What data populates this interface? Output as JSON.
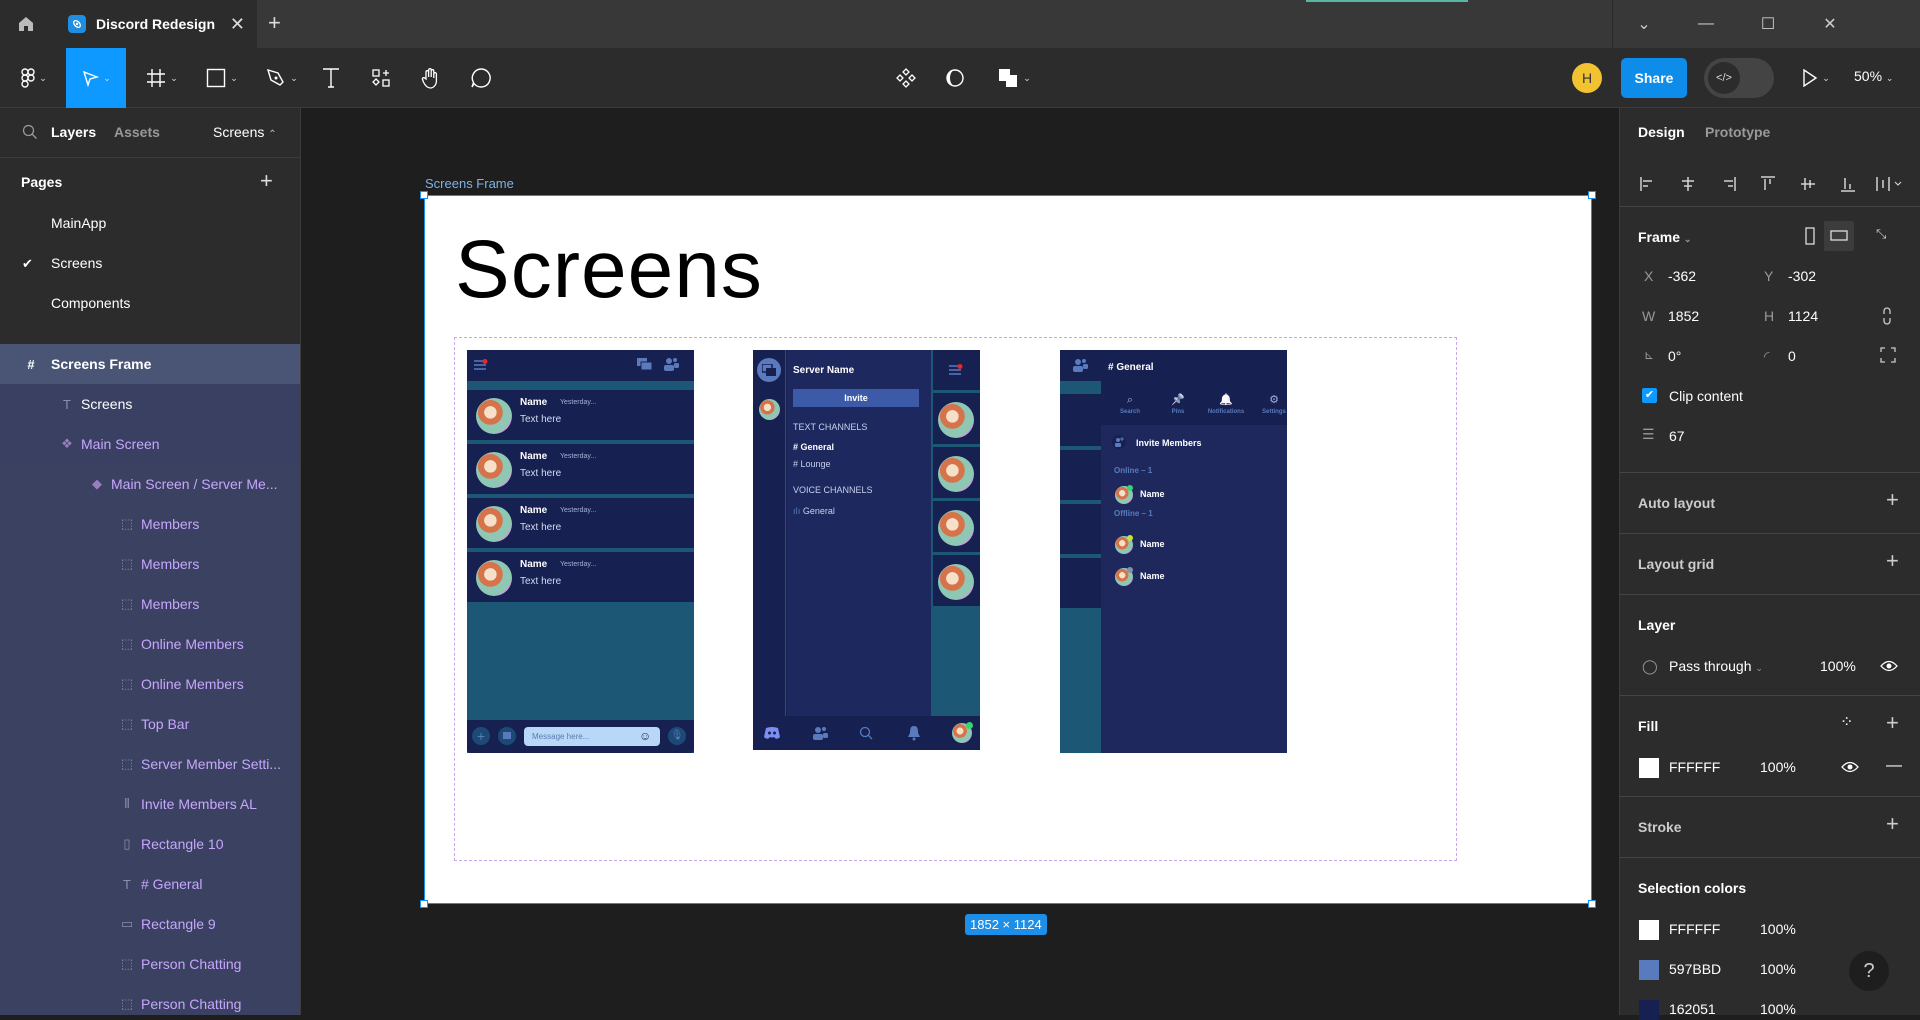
{
  "titlebar": {
    "document_title": "Discord Redesign",
    "new_tab_label": "+"
  },
  "toolbar": {
    "tools": [
      "main-menu",
      "move",
      "frame",
      "shape",
      "pen",
      "text",
      "resources",
      "hand",
      "comment"
    ],
    "center_tools": [
      "components",
      "mask",
      "boolean"
    ],
    "avatar_initial": "H",
    "share_label": "Share",
    "zoom_label": "50%"
  },
  "left_panel": {
    "tabs": {
      "layers": "Layers",
      "assets": "Assets",
      "page_switcher": "Screens"
    },
    "pages_header": "Pages",
    "pages": [
      {
        "label": "MainApp",
        "current": false
      },
      {
        "label": "Screens",
        "current": true
      },
      {
        "label": "Components",
        "current": false
      }
    ],
    "layers": [
      {
        "label": "Screens Frame",
        "icon": "frame-icon",
        "indent": 0,
        "selected": true
      },
      {
        "label": "Screens",
        "icon": "text-icon",
        "indent": 1
      },
      {
        "label": "Main Screen",
        "icon": "component-set-icon",
        "indent": 1
      },
      {
        "label": "Main Screen / Server Me...",
        "icon": "component-variant-icon",
        "indent": 2
      },
      {
        "label": "Members",
        "icon": "group-icon",
        "indent": 3
      },
      {
        "label": "Members",
        "icon": "group-icon",
        "indent": 3
      },
      {
        "label": "Members",
        "icon": "group-icon",
        "indent": 3
      },
      {
        "label": "Online Members",
        "icon": "group-icon",
        "indent": 3
      },
      {
        "label": "Online Members",
        "icon": "group-icon",
        "indent": 3
      },
      {
        "label": "Top Bar",
        "icon": "group-icon",
        "indent": 3
      },
      {
        "label": "Server Member Setti...",
        "icon": "group-icon",
        "indent": 3
      },
      {
        "label": "Invite Members AL",
        "icon": "auto-layout-icon",
        "indent": 3
      },
      {
        "label": "Rectangle 10",
        "icon": "rectangle-vertical-icon",
        "indent": 3
      },
      {
        "label": "# General",
        "icon": "text-icon",
        "indent": 3
      },
      {
        "label": "Rectangle 9",
        "icon": "rectangle-horizontal-icon",
        "indent": 3
      },
      {
        "label": "Person Chatting",
        "icon": "group-icon",
        "indent": 3
      },
      {
        "label": "Person Chatting",
        "icon": "group-icon",
        "indent": 3
      }
    ]
  },
  "canvas": {
    "frame_label": "Screens Frame",
    "frame_title": "Screens",
    "size_badge": "1852 × 1124",
    "screen1": {
      "messages": [
        {
          "name": "Name",
          "time": "Yesterday...",
          "text": "Text here"
        },
        {
          "name": "Name",
          "time": "Yesterday...",
          "text": "Text here"
        },
        {
          "name": "Name",
          "time": "Yesterday...",
          "text": "Text here"
        },
        {
          "name": "Name",
          "time": "Yesterday...",
          "text": "Text here"
        }
      ],
      "message_placeholder": "Message here..."
    },
    "screen2": {
      "server_name": "Server Name",
      "invite_label": "Invite",
      "text_channels_header": "TEXT CHANNELS",
      "text_channels": [
        "# General",
        "# Lounge"
      ],
      "voice_channels_header": "VOICE CHANNELS",
      "voice_channels": [
        "General"
      ]
    },
    "screen3": {
      "channel_title": "# General",
      "actions": [
        "Search",
        "Pins",
        "Notifications",
        "Settings"
      ],
      "invite_members_label": "Invite Members",
      "online_header": "Online – 1",
      "offline_header": "Offline – 1",
      "online_members": [
        "Name"
      ],
      "offline_members": [
        "Name",
        "Name"
      ]
    }
  },
  "right_panel": {
    "tabs": {
      "design": "Design",
      "prototype": "Prototype"
    },
    "frame_section": {
      "title": "Frame",
      "x_label": "X",
      "x": "-362",
      "y_label": "Y",
      "y": "-302",
      "w_label": "W",
      "w": "1852",
      "h_label": "H",
      "h": "1124",
      "rotation": "0°",
      "corner_radius": "0",
      "clip_content_label": "Clip content",
      "clip_content": true,
      "spacing": "67"
    },
    "auto_layout_label": "Auto layout",
    "layout_grid_label": "Layout grid",
    "layer_section": {
      "title": "Layer",
      "blend_mode": "Pass through",
      "opacity": "100%"
    },
    "fill_section": {
      "title": "Fill",
      "color": "FFFFFF",
      "opacity": "100%",
      "swatch": "#FFFFFF"
    },
    "stroke_label": "Stroke",
    "selection_colors": {
      "title": "Selection colors",
      "colors": [
        {
          "hex": "FFFFFF",
          "opacity": "100%",
          "swatch": "#FFFFFF"
        },
        {
          "hex": "597BBD",
          "opacity": "100%",
          "swatch": "#597BBD"
        },
        {
          "hex": "162051",
          "opacity": "100%",
          "swatch": "#162051"
        }
      ]
    },
    "help_label": "?"
  }
}
